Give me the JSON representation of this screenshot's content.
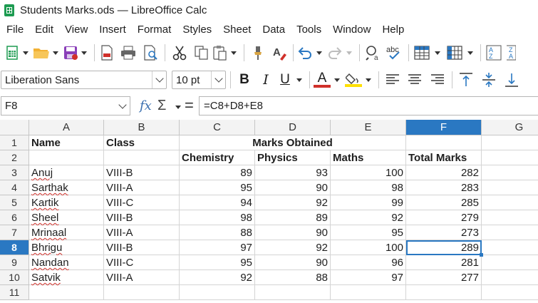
{
  "window": {
    "title": "Students Marks.ods — LibreOffice Calc"
  },
  "menu": [
    "File",
    "Edit",
    "View",
    "Insert",
    "Format",
    "Styles",
    "Sheet",
    "Data",
    "Tools",
    "Window",
    "Help"
  ],
  "format": {
    "font_name": "Liberation Sans",
    "font_size": "10 pt",
    "bold": "B",
    "italic": "I",
    "underline": "U",
    "font_color_letter": "A"
  },
  "colors": {
    "accent": "#2a78c2",
    "font_color": "#d0302a",
    "highlight": "#ffe000",
    "calc_green": "#1d9b51"
  },
  "formula_bar": {
    "name_box": "F8",
    "formula": "=C8+D8+E8"
  },
  "sheet": {
    "columns": [
      "A",
      "B",
      "C",
      "D",
      "E",
      "F",
      "G"
    ],
    "rows": [
      "1",
      "2",
      "3",
      "4",
      "5",
      "6",
      "7",
      "8",
      "9",
      "10",
      "11"
    ],
    "active_cell": "F8",
    "header": {
      "name": "Name",
      "class": "Class",
      "marks_obtained": "Marks Obtained",
      "chemistry": "Chemistry",
      "physics": "Physics",
      "maths": "Maths",
      "total": "Total Marks"
    },
    "students": [
      {
        "name": "Anuj",
        "class": "VIII-B",
        "chemistry": "89",
        "physics": "93",
        "maths": "100",
        "total": "282"
      },
      {
        "name": "Sarthak",
        "class": "VIII-A",
        "chemistry": "95",
        "physics": "90",
        "maths": "98",
        "total": "283"
      },
      {
        "name": "Kartik",
        "class": "VIII-C",
        "chemistry": "94",
        "physics": "92",
        "maths": "99",
        "total": "285"
      },
      {
        "name": "Sheel",
        "class": "VIII-B",
        "chemistry": "98",
        "physics": "89",
        "maths": "92",
        "total": "279"
      },
      {
        "name": "Mrinaal",
        "class": "VIII-A",
        "chemistry": "88",
        "physics": "90",
        "maths": "95",
        "total": "273"
      },
      {
        "name": "Bhrigu",
        "class": "VIII-B",
        "chemistry": "97",
        "physics": "92",
        "maths": "100",
        "total": "289"
      },
      {
        "name": "Nandan",
        "class": "VIII-C",
        "chemistry": "95",
        "physics": "90",
        "maths": "96",
        "total": "281"
      },
      {
        "name": "Satvik",
        "class": "VIII-A",
        "chemistry": "92",
        "physics": "88",
        "maths": "97",
        "total": "277"
      }
    ]
  }
}
